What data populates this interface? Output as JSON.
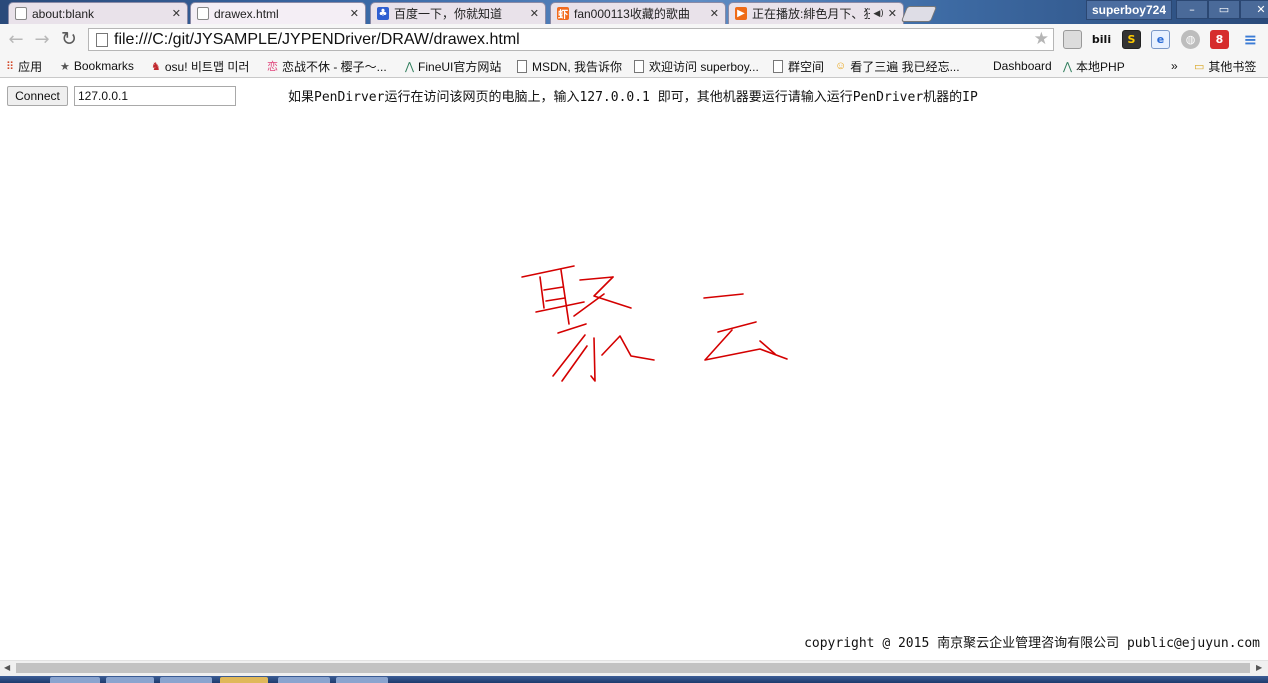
{
  "browser": {
    "tabs": [
      {
        "title": "about:blank",
        "icon": "page-icon",
        "active": false
      },
      {
        "title": "drawex.html",
        "icon": "page-icon",
        "active": true
      },
      {
        "title": "百度一下，你就知道",
        "icon": "baidu-icon",
        "active": false
      },
      {
        "title": "fan000113收藏的歌曲",
        "icon": "xiami-icon",
        "active": false
      },
      {
        "title": "正在播放:緋色月下、狂",
        "icon": "play-icon",
        "active": false,
        "audio": true
      }
    ],
    "profile_name": "superboy724",
    "window_controls": {
      "minimize": "–",
      "restore": "▭",
      "close": "✕"
    },
    "close_glyph": "✕",
    "audio_glyph": "◀)",
    "address": "file:///C:/git/JYSAMPLE/JYPENDriver/DRAW/drawex.html"
  },
  "bookmarks": [
    {
      "label": "应用",
      "icon": "apps-grid-icon"
    },
    {
      "label": "Bookmarks",
      "icon": "star-icon"
    },
    {
      "label": "osu! 비트맵 미러",
      "icon": "osu-icon"
    },
    {
      "label": "恋战不休 - 樱子～...",
      "icon": "heart-icon"
    },
    {
      "label": "FineUI官方网站",
      "icon": "fineui-icon"
    },
    {
      "label": "MSDN, 我告诉你",
      "icon": "page-icon"
    },
    {
      "label": "欢迎访问 superboy...",
      "icon": "page-icon"
    },
    {
      "label": "群空间",
      "icon": "page-icon"
    },
    {
      "label": "看了三遍 我已经忘...",
      "icon": "face-icon"
    },
    {
      "label": "Dashboard",
      "icon": ""
    },
    {
      "label": "本地PHP",
      "icon": "fineui-icon"
    },
    {
      "label": "»",
      "icon": ""
    },
    {
      "label": "其他书签",
      "icon": "folder-icon"
    }
  ],
  "page": {
    "connect_label": "Connect",
    "ip_value": "127.0.0.1",
    "hint": "如果PenDirver运行在访问该网页的电脑上，输入127.0.0.1 即可，其他机器要运行请输入运行PenDriver机器的IP",
    "handwriting_text": "聚 云",
    "stroke_color": "#d40000",
    "footer": "copyright @ 2015 南京聚云企业管理咨询有限公司 public@ejuyun.com"
  },
  "colors": {
    "tabstrip": "#3b6aa8",
    "ink": "#d40000"
  }
}
